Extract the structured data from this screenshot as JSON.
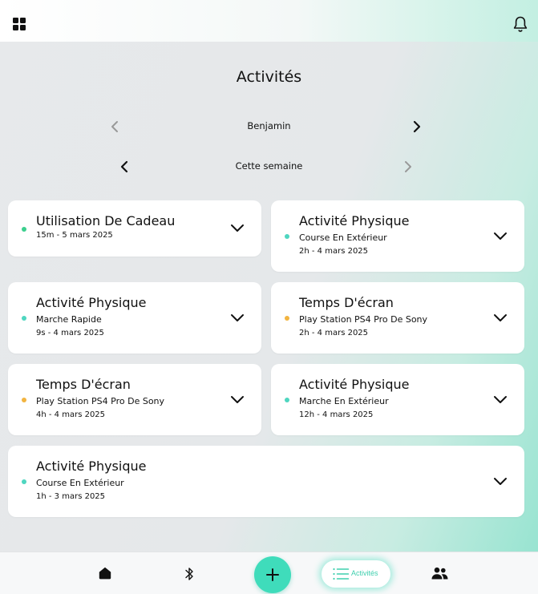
{
  "header": {
    "menu_icon": "grid-icon",
    "notification_icon": "bell-icon"
  },
  "page_title": "Activités",
  "person_selector": {
    "label": "Benjamin"
  },
  "period_selector": {
    "label": "Cette semaine"
  },
  "colors": {
    "accent": "#3fdcbb",
    "dot_green": "#3ccf8e",
    "dot_teal": "#4fd6c0",
    "dot_orange": "#f2b440"
  },
  "activities": [
    {
      "title": "Utilisation De Cadeau",
      "subtitle": "",
      "meta": "15m - 5 mars 2025",
      "dot": "#3ccf8e"
    },
    {
      "title": "Activité Physique",
      "subtitle": "Course En Extérieur",
      "meta": "2h - 4 mars 2025",
      "dot": "#4fd6c0"
    },
    {
      "title": "Activité Physique",
      "subtitle": "Marche Rapide",
      "meta": "9s - 4 mars 2025",
      "dot": "#4fd6c0"
    },
    {
      "title": "Temps D'écran",
      "subtitle": "Play Station PS4 Pro De Sony",
      "meta": "2h - 4 mars 2025",
      "dot": "#f2b440"
    },
    {
      "title": "Temps D'écran",
      "subtitle": "Play Station PS4 Pro De Sony",
      "meta": "4h - 4 mars 2025",
      "dot": "#f2b440"
    },
    {
      "title": "Activité Physique",
      "subtitle": "Marche En Extérieur",
      "meta": "12h - 4 mars 2025",
      "dot": "#4fd6c0"
    },
    {
      "title": "Activité Physique",
      "subtitle": "Course En Extérieur",
      "meta": "1h - 3 mars 2025",
      "dot": "#4fd6c0"
    }
  ],
  "bottom_nav": {
    "items": [
      {
        "icon": "home-icon"
      },
      {
        "icon": "bluetooth-icon"
      },
      {
        "icon": "plus-icon"
      },
      {
        "icon": "list-icon",
        "label": "Activités",
        "active": true
      },
      {
        "icon": "users-icon"
      }
    ]
  }
}
